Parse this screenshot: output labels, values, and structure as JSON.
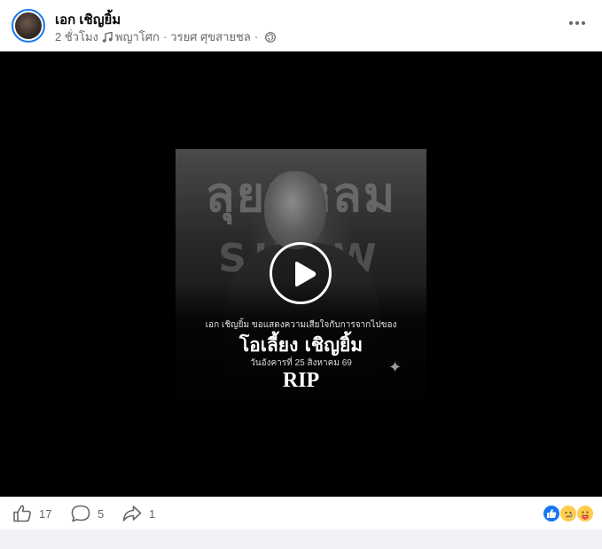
{
  "post": {
    "author": "เอก เชิญยิ้ม",
    "time": "2 ชั่วโมง",
    "music": "พญาโศก",
    "artist": "วรยศ ศุขสายชล",
    "separator": "·",
    "privacy_icon": "globe-icon",
    "music_icon": "music-note-icon",
    "more_icon": "more-horizontal-icon"
  },
  "video": {
    "sign_text": "ลุยแหลม",
    "sign_show": "SHOW",
    "tribute_line": "เอก เชิญยิ้ม ขอแสดงความเสียใจกับการจากไปของ",
    "deceased_name": "โอเลี้ยง เชิญยิ้ม",
    "date_line": "วันอังคารที่ 25 สิงหาคม 69",
    "rip": "RIP",
    "sparkle": "✦",
    "play_icon": "play-icon"
  },
  "actions": {
    "likes": "17",
    "comments": "5",
    "shares": "1",
    "like_icon": "thumbs-up-icon",
    "comment_icon": "comment-icon",
    "share_icon": "share-icon",
    "reactions": [
      "like-reaction-icon",
      "sad-reaction-icon",
      "care-reaction-icon"
    ]
  },
  "colors": {
    "accent": "#1877f2",
    "secondary_text": "#65676b",
    "video_bg": "#000000"
  }
}
